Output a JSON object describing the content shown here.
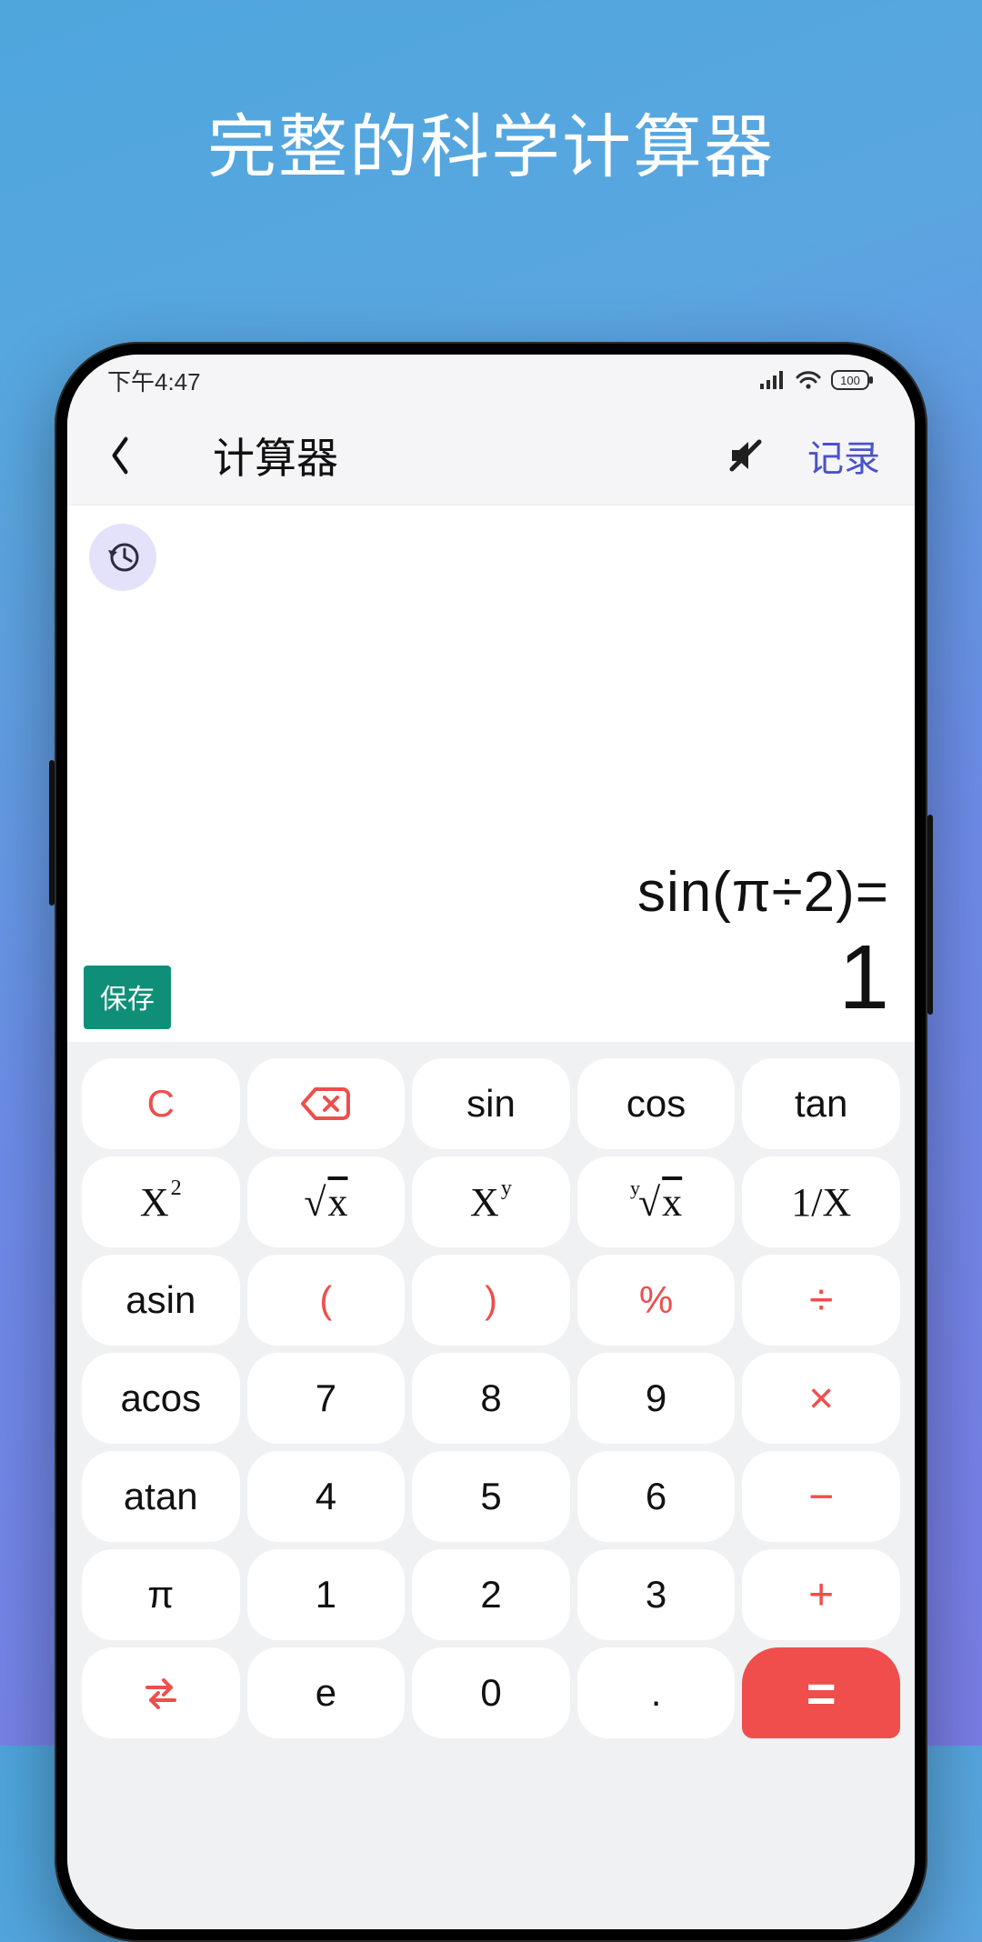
{
  "promo": {
    "title": "完整的科学计算器"
  },
  "statusbar": {
    "time": "下午4:47",
    "battery": "100"
  },
  "navbar": {
    "title": "计算器",
    "history_label": "记录"
  },
  "display": {
    "expression": "sin(π÷2)=",
    "result": "1",
    "save_label": "保存"
  },
  "keys": {
    "r1": {
      "c": "C",
      "bs": "⌫",
      "sin": "sin",
      "cos": "cos",
      "tan": "tan"
    },
    "r2": {
      "sq_base": "X",
      "sq_sup": "2",
      "sqrt_pre": "√",
      "sqrt_x": "x",
      "pow_base": "X",
      "pow_sup": "y",
      "nroot_pre": "y",
      "nroot_sym": "√",
      "nroot_x": "x",
      "inv": "1/X"
    },
    "r3": {
      "asin": "asin",
      "lparen": "(",
      "rparen": ")",
      "pct": "%",
      "div": "÷"
    },
    "r4": {
      "acos": "acos",
      "d7": "7",
      "d8": "8",
      "d9": "9",
      "mul": "×"
    },
    "r5": {
      "atan": "atan",
      "d4": "4",
      "d5": "5",
      "d6": "6",
      "sub": "−"
    },
    "r6": {
      "pi": "π",
      "d1": "1",
      "d2": "2",
      "d3": "3",
      "add": "+"
    },
    "r7": {
      "swap": "⇆",
      "e": "e",
      "d0": "0",
      "dot": ".",
      "eq": "="
    }
  }
}
